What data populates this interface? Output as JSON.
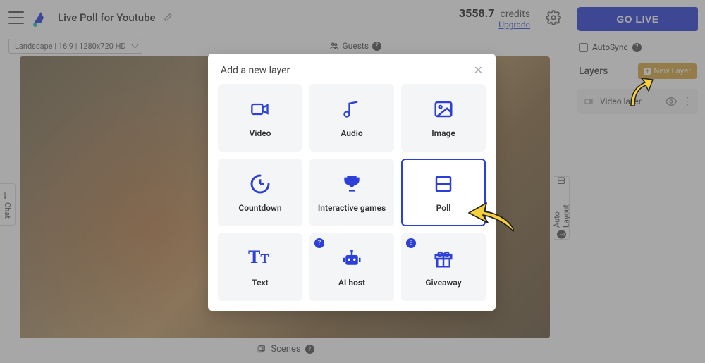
{
  "header": {
    "project_title": "Live Poll for Youtube",
    "credits_value": "3558.7",
    "credits_label": "credits",
    "upgrade_label": "Upgrade"
  },
  "toolbar": {
    "resolution": "Landscape | 16:9 | 1280x720 HD",
    "guests_label": "Guests",
    "scenes_label": "Scenes",
    "chat_label": "Chat",
    "autolayout_label": "Auto Layout"
  },
  "sidebar": {
    "go_live": "GO LIVE",
    "autosync": "AutoSync",
    "layers_title": "Layers",
    "new_layer": "New Layer",
    "layer1": "Video layer"
  },
  "modal": {
    "title": "Add a new layer",
    "cards": {
      "video": "Video",
      "audio": "Audio",
      "image": "Image",
      "countdown": "Countdown",
      "games": "Interactive games",
      "poll": "Poll",
      "text": "Text",
      "aihost": "AI host",
      "giveaway": "Giveaway"
    }
  }
}
